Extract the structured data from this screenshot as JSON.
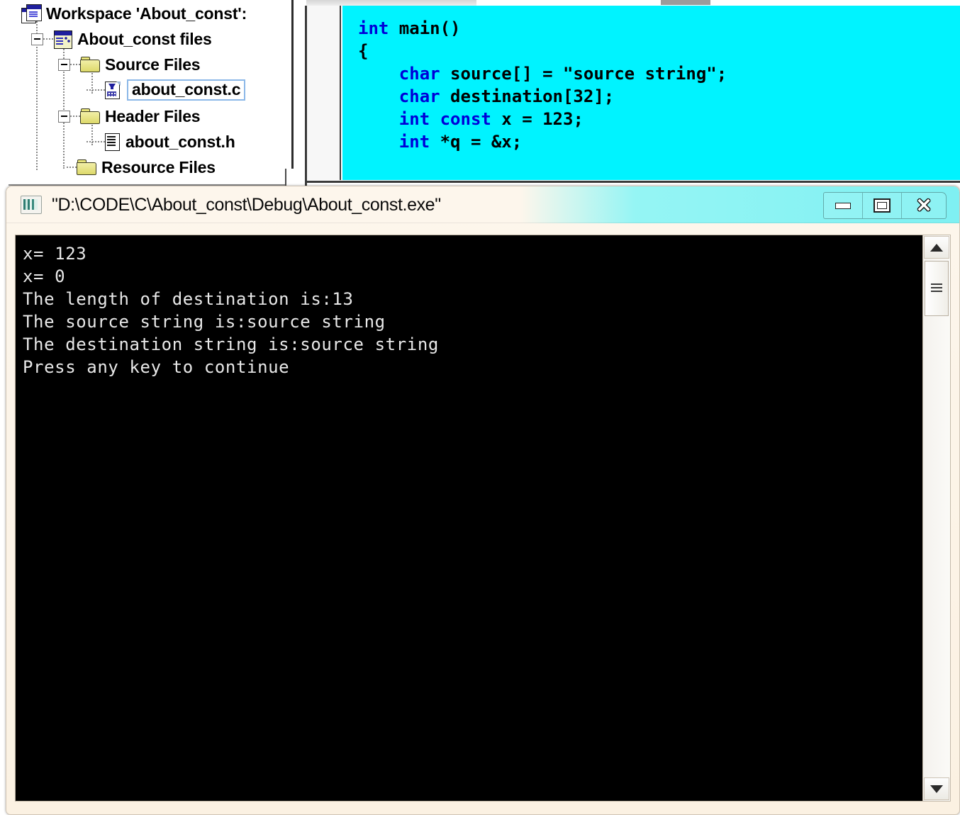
{
  "ide": {
    "tree": {
      "root_label": "Workspace 'About_const':",
      "items": [
        {
          "label": "About_const files",
          "icon": "project-icon",
          "level": 1,
          "expander": true
        },
        {
          "label": "Source Files",
          "icon": "folder-icon",
          "level": 2,
          "expander": true
        },
        {
          "label": "about_const.c",
          "icon": "c-source-file-icon",
          "level": 3,
          "expander": false,
          "selected": true
        },
        {
          "label": "Header Files",
          "icon": "folder-icon",
          "level": 2,
          "expander": true
        },
        {
          "label": "about_const.h",
          "icon": "header-file-icon",
          "level": 3,
          "expander": false
        },
        {
          "label": "Resource Files",
          "icon": "folder-icon",
          "level": 2,
          "expander": false
        }
      ]
    },
    "editor": {
      "background_color": "#00f3ff",
      "keyword_color": "#0000d8",
      "lines": [
        {
          "segments": [
            {
              "t": "int",
              "kw": true
            },
            {
              "t": " main()",
              "kw": false
            }
          ]
        },
        {
          "segments": [
            {
              "t": "{",
              "kw": false
            }
          ]
        },
        {
          "segments": [
            {
              "t": "    ",
              "kw": false
            },
            {
              "t": "char",
              "kw": true
            },
            {
              "t": " source[] = \"source string\";",
              "kw": false
            }
          ]
        },
        {
          "segments": [
            {
              "t": "    ",
              "kw": false
            },
            {
              "t": "char",
              "kw": true
            },
            {
              "t": " destination[32];",
              "kw": false
            }
          ]
        },
        {
          "segments": [
            {
              "t": "    ",
              "kw": false
            },
            {
              "t": "int const",
              "kw": true
            },
            {
              "t": " x = 123;",
              "kw": false
            }
          ]
        },
        {
          "segments": [
            {
              "t": "    ",
              "kw": false
            },
            {
              "t": "int",
              "kw": true
            },
            {
              "t": " *q = &x;",
              "kw": false
            }
          ]
        }
      ]
    }
  },
  "console": {
    "title": "\"D:\\CODE\\C\\About_const\\Debug\\About_const.exe\"",
    "icon": "console-window-icon",
    "window_controls": {
      "minimize_label": "Minimize",
      "maximize_label": "Restore",
      "close_label": "Close",
      "close_glyph": "✕"
    },
    "output_lines": [
      "x= 123",
      "x= 0",
      "The length of destination is:13",
      "The source string is:source string",
      "The destination string is:source string",
      "Press any key to continue"
    ],
    "background_color": "#000000",
    "text_color": "#e8e8e8",
    "scrollbar": {
      "up_label": "Scroll up",
      "down_label": "Scroll down",
      "thumb_label": "Scroll thumb"
    }
  }
}
